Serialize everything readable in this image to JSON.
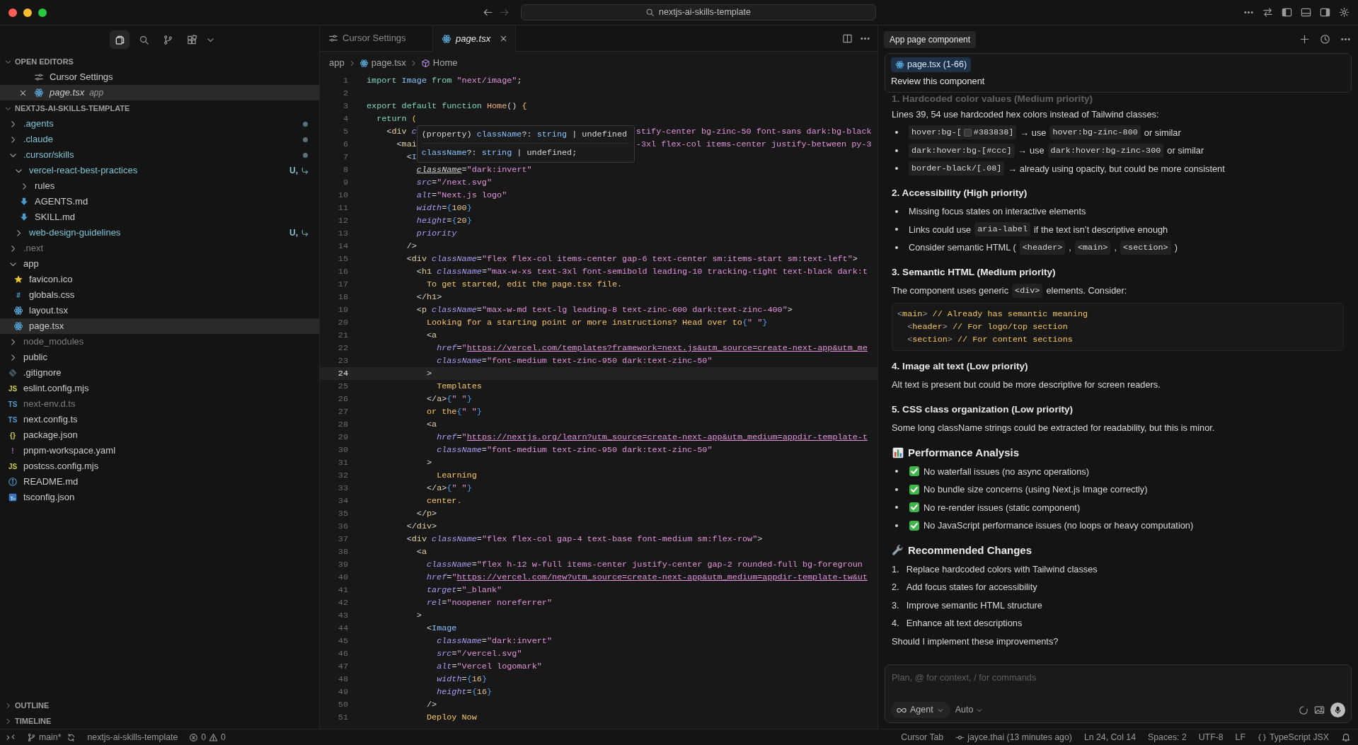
{
  "titlebar": {
    "search": "nextjs-ai-skills-template"
  },
  "sidebar": {
    "views": [
      {
        "kind": "files",
        "selected": true
      },
      {
        "kind": "search",
        "selected": false
      },
      {
        "kind": "source_control",
        "selected": false
      },
      {
        "kind": "extensions",
        "selected": false
      }
    ],
    "open_editors": {
      "title": "OPEN EDITORS",
      "expanded": true,
      "items": [
        {
          "label": "Cursor Settings",
          "kind": "settings_file",
          "selected": false
        },
        {
          "label": "page.tsx",
          "detail": "app",
          "kind": "react_file",
          "selected": true
        }
      ]
    },
    "explorer": {
      "title": "NEXTJS-AI-SKILLS-TEMPLATE",
      "expanded": true,
      "items": [
        {
          "label": ".agents",
          "kind": "folder",
          "expanded": false,
          "selected": false,
          "git_changed": true,
          "dot": true
        },
        {
          "label": ".claude",
          "kind": "folder",
          "expanded": false,
          "selected": false,
          "git_changed": true,
          "dot": true
        },
        {
          "label": ".cursor/skills",
          "kind": "folder",
          "expanded": true,
          "selected": false,
          "git_changed": true,
          "dot": true,
          "children": [
            {
              "label": "vercel-react-best-practices",
              "kind": "folder",
              "expanded": true,
              "selected": false,
              "git_changed": true,
              "decoration": "U,",
              "linked": true,
              "children": [
                {
                  "label": "rules",
                  "kind": "folder",
                  "expanded": false,
                  "selected": false
                },
                {
                  "label": "AGENTS.md",
                  "kind": "markdown_file",
                  "selected": false
                },
                {
                  "label": "SKILL.md",
                  "kind": "markdown_file",
                  "selected": false
                }
              ]
            },
            {
              "label": "web-design-guidelines",
              "kind": "folder",
              "expanded": false,
              "selected": false,
              "git_changed": true,
              "decoration": "U,",
              "linked": true
            }
          ]
        },
        {
          "label": ".next",
          "kind": "folder",
          "expanded": false,
          "selected": false,
          "ignored": true
        },
        {
          "label": "app",
          "kind": "folder",
          "expanded": true,
          "selected": false,
          "children": [
            {
              "label": "favicon.ico",
              "kind": "favicon_file",
              "selected": false
            },
            {
              "label": "globals.css",
              "kind": "css_file",
              "icon_text": "#",
              "selected": false
            },
            {
              "label": "layout.tsx",
              "kind": "react_file",
              "selected": false
            },
            {
              "label": "page.tsx",
              "kind": "react_file",
              "selected": true
            }
          ]
        },
        {
          "label": "node_modules",
          "kind": "folder",
          "expanded": false,
          "selected": false,
          "ignored": true
        },
        {
          "label": "public",
          "kind": "folder",
          "expanded": false,
          "selected": false
        },
        {
          "label": ".gitignore",
          "kind": "gitignore_file",
          "selected": false
        },
        {
          "label": "eslint.config.mjs",
          "kind": "js_file",
          "icon_text": "JS",
          "selected": false
        },
        {
          "label": "next-env.d.ts",
          "kind": "ts_file",
          "icon_text": "TS",
          "selected": false,
          "ignored": true
        },
        {
          "label": "next.config.ts",
          "kind": "ts_file",
          "icon_text": "TS",
          "selected": false
        },
        {
          "label": "package.json",
          "kind": "json_file",
          "icon_text": "{}",
          "selected": false
        },
        {
          "label": "pnpm-workspace.yaml",
          "kind": "yaml_file",
          "icon_text": "!",
          "selected": false
        },
        {
          "label": "postcss.config.mjs",
          "kind": "js_file",
          "icon_text": "JS",
          "selected": false
        },
        {
          "label": "README.md",
          "kind": "readme_file",
          "selected": false
        },
        {
          "label": "tsconfig.json",
          "kind": "tsconfig_file",
          "selected": false
        }
      ]
    },
    "collapsed_sections": [
      {
        "title": "OUTLINE",
        "expanded": false
      },
      {
        "title": "TIMELINE",
        "expanded": false
      }
    ]
  },
  "editor": {
    "tabs": [
      {
        "label": "Cursor Settings",
        "kind": "settings_file",
        "selected": false
      },
      {
        "label": "page.tsx",
        "kind": "react_file",
        "selected": true
      }
    ],
    "breadcrumb": [
      {
        "text": "app",
        "kind": "folder"
      },
      {
        "text": "page.tsx",
        "kind": "react_file"
      },
      {
        "text": "Home",
        "kind": "symbol"
      }
    ],
    "hover": {
      "lines": [
        {
          "tokens": [
            {
              "kind": "plain",
              "text": "(property) "
            },
            {
              "kind": "component",
              "text": "className"
            },
            {
              "kind": "plain",
              "text": "?: "
            },
            {
              "kind": "component",
              "text": "string"
            },
            {
              "kind": "plain",
              "text": " | undefined"
            }
          ]
        },
        {
          "tokens": [
            {
              "kind": "component",
              "text": "className"
            },
            {
              "kind": "plain",
              "text": "?: "
            },
            {
              "kind": "component",
              "text": "string"
            },
            {
              "kind": "plain",
              "text": " | undefined;"
            }
          ]
        }
      ]
    },
    "lines": [
      {
        "number": "1",
        "current": false,
        "tokens": [
          {
            "kind": "keyword",
            "text": "import "
          },
          {
            "kind": "component",
            "text": "Image"
          },
          {
            "kind": "keyword",
            "text": " from "
          },
          {
            "kind": "string",
            "text": "\"next/image\""
          },
          {
            "kind": "punct",
            "text": ";"
          }
        ]
      },
      {
        "number": "2",
        "current": false
      },
      {
        "number": "3",
        "current": false,
        "tokens": [
          {
            "kind": "keyword",
            "text": "export default function "
          },
          {
            "kind": "function",
            "text": "Home"
          },
          {
            "kind": "punct",
            "text": "() "
          },
          {
            "kind": "bracket",
            "text": "{"
          }
        ]
      },
      {
        "number": "4",
        "current": false,
        "tokens": [
          {
            "kind": "keyword",
            "text": "  return "
          },
          {
            "kind": "bracket",
            "text": "("
          }
        ]
      },
      {
        "number": "5",
        "current": false,
        "tokens": [
          {
            "kind": "punct",
            "text": "    <"
          },
          {
            "kind": "tag",
            "text": "div"
          },
          {
            "kind": "attr",
            "text": " c"
          }
        ],
        "after_popup": [
          {
            "kind": "string",
            "text": "stify-center bg-zinc-50 font-sans dark:bg-black"
          }
        ]
      },
      {
        "number": "6",
        "current": false,
        "tokens": [
          {
            "kind": "punct",
            "text": "      <"
          },
          {
            "kind": "tag",
            "text": "mai"
          }
        ],
        "after_popup": [
          {
            "kind": "string",
            "text": "-3xl flex-col items-center justify-between py-3"
          }
        ]
      },
      {
        "number": "7",
        "current": false,
        "tokens": [
          {
            "kind": "punct",
            "text": "        <"
          },
          {
            "kind": "component",
            "text": "I"
          }
        ]
      },
      {
        "number": "8",
        "current": false,
        "tokens": [
          {
            "kind": "attr",
            "text": "          className",
            "underline": true
          },
          {
            "kind": "punct",
            "text": "="
          },
          {
            "kind": "string",
            "text": "\"dark:invert\""
          }
        ]
      },
      {
        "number": "9",
        "current": false,
        "tokens": [
          {
            "kind": "attr",
            "text": "          src"
          },
          {
            "kind": "punct",
            "text": "="
          },
          {
            "kind": "string",
            "text": "\"/next.svg\""
          }
        ]
      },
      {
        "number": "10",
        "current": false,
        "tokens": [
          {
            "kind": "attr",
            "text": "          alt"
          },
          {
            "kind": "punct",
            "text": "="
          },
          {
            "kind": "string",
            "text": "\"Next.js logo\""
          }
        ]
      },
      {
        "number": "11",
        "current": false,
        "tokens": [
          {
            "kind": "attr",
            "text": "          width"
          },
          {
            "kind": "punct",
            "text": "="
          },
          {
            "kind": "brace",
            "text": "{"
          },
          {
            "kind": "number",
            "text": "100"
          },
          {
            "kind": "brace",
            "text": "}"
          }
        ]
      },
      {
        "number": "12",
        "current": false,
        "tokens": [
          {
            "kind": "attr",
            "text": "          height"
          },
          {
            "kind": "punct",
            "text": "="
          },
          {
            "kind": "brace",
            "text": "{"
          },
          {
            "kind": "number",
            "text": "20"
          },
          {
            "kind": "brace",
            "text": "}"
          }
        ]
      },
      {
        "number": "13",
        "current": false,
        "tokens": [
          {
            "kind": "attr",
            "text": "          priority"
          }
        ]
      },
      {
        "number": "14",
        "current": false,
        "tokens": [
          {
            "kind": "punct",
            "text": "        />"
          }
        ]
      },
      {
        "number": "15",
        "current": false,
        "tokens": [
          {
            "kind": "punct",
            "text": "        <"
          },
          {
            "kind": "tag",
            "text": "div"
          },
          {
            "kind": "attr",
            "text": " className"
          },
          {
            "kind": "punct",
            "text": "="
          },
          {
            "kind": "string",
            "text": "\"flex flex-col items-center gap-6 text-center sm:items-start sm:text-left\""
          },
          {
            "kind": "punct",
            "text": ">"
          }
        ]
      },
      {
        "number": "16",
        "current": false,
        "tokens": [
          {
            "kind": "punct",
            "text": "          <"
          },
          {
            "kind": "tag",
            "text": "h1"
          },
          {
            "kind": "attr",
            "text": " className"
          },
          {
            "kind": "punct",
            "text": "="
          },
          {
            "kind": "string",
            "text": "\"max-w-xs text-3xl font-semibold leading-10 tracking-tight text-black dark:t"
          }
        ]
      },
      {
        "number": "17",
        "current": false,
        "tokens": [
          {
            "kind": "text",
            "text": "            To get started, edit the page.tsx file."
          }
        ]
      },
      {
        "number": "18",
        "current": false,
        "tokens": [
          {
            "kind": "punct",
            "text": "          </"
          },
          {
            "kind": "tag",
            "text": "h1"
          },
          {
            "kind": "punct",
            "text": ">"
          }
        ]
      },
      {
        "number": "19",
        "current": false,
        "tokens": [
          {
            "kind": "punct",
            "text": "          <"
          },
          {
            "kind": "tag",
            "text": "p"
          },
          {
            "kind": "attr",
            "text": " className"
          },
          {
            "kind": "punct",
            "text": "="
          },
          {
            "kind": "string",
            "text": "\"max-w-md text-lg leading-8 text-zinc-600 dark:text-zinc-400\""
          },
          {
            "kind": "punct",
            "text": ">"
          }
        ]
      },
      {
        "number": "20",
        "current": false,
        "tokens": [
          {
            "kind": "text",
            "text": "            Looking for a starting point or more instructions? Head over to"
          },
          {
            "kind": "brace",
            "text": "{"
          },
          {
            "kind": "string",
            "text": "\" \""
          },
          {
            "kind": "brace",
            "text": "}"
          }
        ]
      },
      {
        "number": "21",
        "current": false,
        "tokens": [
          {
            "kind": "punct",
            "text": "            <"
          },
          {
            "kind": "tag",
            "text": "a"
          }
        ]
      },
      {
        "number": "22",
        "current": false,
        "tokens": [
          {
            "kind": "attr",
            "text": "              href"
          },
          {
            "kind": "punct",
            "text": "="
          },
          {
            "kind": "string",
            "text": "\""
          },
          {
            "kind": "link",
            "text": "https://vercel.com/templates?framework=next.js&utm_source=create-next-app&utm_me"
          }
        ]
      },
      {
        "number": "23",
        "current": false,
        "tokens": [
          {
            "kind": "attr",
            "text": "              className"
          },
          {
            "kind": "punct",
            "text": "="
          },
          {
            "kind": "string",
            "text": "\"font-medium text-zinc-950 dark:text-zinc-50\""
          }
        ]
      },
      {
        "number": "24",
        "current": true,
        "tokens": [
          {
            "kind": "punct",
            "text": "            >"
          }
        ]
      },
      {
        "number": "25",
        "current": false,
        "tokens": [
          {
            "kind": "text",
            "text": "              Templates"
          }
        ]
      },
      {
        "number": "26",
        "current": false,
        "tokens": [
          {
            "kind": "punct",
            "text": "            </"
          },
          {
            "kind": "tag",
            "text": "a"
          },
          {
            "kind": "punct",
            "text": ">"
          },
          {
            "kind": "brace",
            "text": "{"
          },
          {
            "kind": "string",
            "text": "\" \""
          },
          {
            "kind": "brace",
            "text": "}"
          }
        ]
      },
      {
        "number": "27",
        "current": false,
        "tokens": [
          {
            "kind": "text",
            "text": "            or the"
          },
          {
            "kind": "brace",
            "text": "{"
          },
          {
            "kind": "string",
            "text": "\" \""
          },
          {
            "kind": "brace",
            "text": "}"
          }
        ]
      },
      {
        "number": "28",
        "current": false,
        "tokens": [
          {
            "kind": "punct",
            "text": "            <"
          },
          {
            "kind": "tag",
            "text": "a"
          }
        ]
      },
      {
        "number": "29",
        "current": false,
        "tokens": [
          {
            "kind": "attr",
            "text": "              href"
          },
          {
            "kind": "punct",
            "text": "="
          },
          {
            "kind": "string",
            "text": "\""
          },
          {
            "kind": "link",
            "text": "https://nextjs.org/learn?utm_source=create-next-app&utm_medium=appdir-template-t"
          }
        ]
      },
      {
        "number": "30",
        "current": false,
        "tokens": [
          {
            "kind": "attr",
            "text": "              className"
          },
          {
            "kind": "punct",
            "text": "="
          },
          {
            "kind": "string",
            "text": "\"font-medium text-zinc-950 dark:text-zinc-50\""
          }
        ]
      },
      {
        "number": "31",
        "current": false,
        "tokens": [
          {
            "kind": "punct",
            "text": "            >"
          }
        ]
      },
      {
        "number": "32",
        "current": false,
        "tokens": [
          {
            "kind": "text",
            "text": "              Learning"
          }
        ]
      },
      {
        "number": "33",
        "current": false,
        "tokens": [
          {
            "kind": "punct",
            "text": "            </"
          },
          {
            "kind": "tag",
            "text": "a"
          },
          {
            "kind": "punct",
            "text": ">"
          },
          {
            "kind": "brace",
            "text": "{"
          },
          {
            "kind": "string",
            "text": "\" \""
          },
          {
            "kind": "brace",
            "text": "}"
          }
        ]
      },
      {
        "number": "34",
        "current": false,
        "tokens": [
          {
            "kind": "text",
            "text": "            center."
          }
        ]
      },
      {
        "number": "35",
        "current": false,
        "tokens": [
          {
            "kind": "punct",
            "text": "          </"
          },
          {
            "kind": "tag",
            "text": "p"
          },
          {
            "kind": "punct",
            "text": ">"
          }
        ]
      },
      {
        "number": "36",
        "current": false,
        "tokens": [
          {
            "kind": "punct",
            "text": "        </"
          },
          {
            "kind": "tag",
            "text": "div"
          },
          {
            "kind": "punct",
            "text": ">"
          }
        ]
      },
      {
        "number": "37",
        "current": false,
        "tokens": [
          {
            "kind": "punct",
            "text": "        <"
          },
          {
            "kind": "tag",
            "text": "div"
          },
          {
            "kind": "attr",
            "text": " className"
          },
          {
            "kind": "punct",
            "text": "="
          },
          {
            "kind": "string",
            "text": "\"flex flex-col gap-4 text-base font-medium sm:flex-row\""
          },
          {
            "kind": "punct",
            "text": ">"
          }
        ]
      },
      {
        "number": "38",
        "current": false,
        "tokens": [
          {
            "kind": "punct",
            "text": "          <"
          },
          {
            "kind": "tag",
            "text": "a"
          }
        ]
      },
      {
        "number": "39",
        "current": false,
        "tokens": [
          {
            "kind": "attr",
            "text": "            className"
          },
          {
            "kind": "punct",
            "text": "="
          },
          {
            "kind": "string",
            "text": "\"flex h-12 w-full items-center justify-center gap-2 rounded-full bg-foregroun"
          }
        ]
      },
      {
        "number": "40",
        "current": false,
        "tokens": [
          {
            "kind": "attr",
            "text": "            href"
          },
          {
            "kind": "punct",
            "text": "="
          },
          {
            "kind": "string",
            "text": "\""
          },
          {
            "kind": "link",
            "text": "https://vercel.com/new?utm_source=create-next-app&utm_medium=appdir-template-tw&ut"
          }
        ]
      },
      {
        "number": "41",
        "current": false,
        "tokens": [
          {
            "kind": "attr",
            "text": "            target"
          },
          {
            "kind": "punct",
            "text": "="
          },
          {
            "kind": "string",
            "text": "\"_blank\""
          }
        ]
      },
      {
        "number": "42",
        "current": false,
        "tokens": [
          {
            "kind": "attr",
            "text": "            rel"
          },
          {
            "kind": "punct",
            "text": "="
          },
          {
            "kind": "string",
            "text": "\"noopener noreferrer\""
          }
        ]
      },
      {
        "number": "43",
        "current": false,
        "tokens": [
          {
            "kind": "punct",
            "text": "          >"
          }
        ]
      },
      {
        "number": "44",
        "current": false,
        "tokens": [
          {
            "kind": "punct",
            "text": "            <"
          },
          {
            "kind": "component",
            "text": "Image"
          }
        ]
      },
      {
        "number": "45",
        "current": false,
        "tokens": [
          {
            "kind": "attr",
            "text": "              className"
          },
          {
            "kind": "punct",
            "text": "="
          },
          {
            "kind": "string",
            "text": "\"dark:invert\""
          }
        ]
      },
      {
        "number": "46",
        "current": false,
        "tokens": [
          {
            "kind": "attr",
            "text": "              src"
          },
          {
            "kind": "punct",
            "text": "="
          },
          {
            "kind": "string",
            "text": "\"/vercel.svg\""
          }
        ]
      },
      {
        "number": "47",
        "current": false,
        "tokens": [
          {
            "kind": "attr",
            "text": "              alt"
          },
          {
            "kind": "punct",
            "text": "="
          },
          {
            "kind": "string",
            "text": "\"Vercel logomark\""
          }
        ]
      },
      {
        "number": "48",
        "current": false,
        "tokens": [
          {
            "kind": "attr",
            "text": "              width"
          },
          {
            "kind": "punct",
            "text": "="
          },
          {
            "kind": "brace",
            "text": "{"
          },
          {
            "kind": "number",
            "text": "16"
          },
          {
            "kind": "brace",
            "text": "}"
          }
        ]
      },
      {
        "number": "49",
        "current": false,
        "tokens": [
          {
            "kind": "attr",
            "text": "              height"
          },
          {
            "kind": "punct",
            "text": "="
          },
          {
            "kind": "brace",
            "text": "{"
          },
          {
            "kind": "number",
            "text": "16"
          },
          {
            "kind": "brace",
            "text": "}"
          }
        ]
      },
      {
        "number": "50",
        "current": false,
        "tokens": [
          {
            "kind": "punct",
            "text": "            />"
          }
        ]
      },
      {
        "number": "51",
        "current": false,
        "tokens": [
          {
            "kind": "text",
            "text": "            Deploy Now"
          }
        ]
      }
    ]
  },
  "chat": {
    "title": "App page component",
    "context": {
      "file": "page.tsx (1-66)",
      "prompt": "Review this component"
    },
    "blocks": [
      {
        "kind": "heading",
        "faded": true,
        "text": "1. Hardcoded color values (Medium priority)"
      },
      {
        "kind": "paragraph",
        "segments": [
          {
            "kind": "text",
            "text": "Lines 39, 54 use hardcoded hex colors instead of Tailwind classes:"
          }
        ]
      },
      {
        "kind": "bullets",
        "items": [
          {
            "segments": [
              {
                "kind": "code",
                "text": "hover:bg-[",
                "color": "#383838",
                "text_after": "#383838]"
              },
              {
                "kind": "text",
                "text": "→ use"
              },
              {
                "kind": "code",
                "text": "hover:bg-zinc-800"
              },
              {
                "kind": "text",
                "text": "or similar"
              }
            ]
          },
          {
            "segments": [
              {
                "kind": "code",
                "text": "dark:hover:bg-[#ccc]"
              },
              {
                "kind": "text",
                "text": "→ use"
              },
              {
                "kind": "code",
                "text": "dark:hover:bg-zinc-300"
              },
              {
                "kind": "text",
                "text": "or similar"
              }
            ]
          },
          {
            "segments": [
              {
                "kind": "code",
                "text": "border-black/[.08]"
              },
              {
                "kind": "text",
                "text": "→ already using opacity, but could be more consistent"
              }
            ]
          }
        ]
      },
      {
        "kind": "heading",
        "faded": false,
        "text": "2. Accessibility (High priority)"
      },
      {
        "kind": "bullets",
        "items": [
          {
            "segments": [
              {
                "kind": "text",
                "text": "Missing focus states on interactive elements"
              }
            ]
          },
          {
            "segments": [
              {
                "kind": "text",
                "text": "Links could use"
              },
              {
                "kind": "code",
                "text": "aria-label"
              },
              {
                "kind": "text",
                "text": "if the text isn’t descriptive enough"
              }
            ]
          },
          {
            "segments": [
              {
                "kind": "text",
                "text": "Consider semantic HTML ("
              },
              {
                "kind": "code",
                "text": "<header>"
              },
              {
                "kind": "text",
                "text": ","
              },
              {
                "kind": "code",
                "text": "<main>"
              },
              {
                "kind": "text",
                "text": ","
              },
              {
                "kind": "code",
                "text": "<section>"
              },
              {
                "kind": "text",
                "text": ")"
              }
            ]
          }
        ]
      },
      {
        "kind": "heading",
        "faded": false,
        "text": "3. Semantic HTML (Medium priority)"
      },
      {
        "kind": "paragraph",
        "segments": [
          {
            "kind": "text",
            "text": "The component uses generic"
          },
          {
            "kind": "code",
            "text": "<div>"
          },
          {
            "kind": "text",
            "text": "elements. Consider:"
          }
        ]
      },
      {
        "kind": "code_block",
        "lines": [
          {
            "tokens": [
              {
                "kind": "punct",
                "text": "<"
              },
              {
                "kind": "text",
                "text": "main"
              },
              {
                "kind": "punct",
                "text": ">"
              },
              {
                "kind": "text",
                "text": " // Already has semantic meaning"
              }
            ]
          },
          {
            "tokens": [
              {
                "kind": "punct",
                "text": "  <"
              },
              {
                "kind": "text",
                "text": "header"
              },
              {
                "kind": "punct",
                "text": ">"
              },
              {
                "kind": "text",
                "text": " // For logo/top section"
              }
            ]
          },
          {
            "tokens": [
              {
                "kind": "punct",
                "text": "  <"
              },
              {
                "kind": "text",
                "text": "section"
              },
              {
                "kind": "punct",
                "text": ">"
              },
              {
                "kind": "text",
                "text": " // For content sections"
              }
            ]
          }
        ]
      },
      {
        "kind": "heading",
        "faded": false,
        "text": "4. Image alt text (Low priority)"
      },
      {
        "kind": "paragraph",
        "segments": [
          {
            "kind": "text",
            "text": "Alt text is present but could be more descriptive for screen readers."
          }
        ]
      },
      {
        "kind": "heading",
        "faded": false,
        "text": "5. CSS class organization (Low priority)"
      },
      {
        "kind": "paragraph",
        "segments": [
          {
            "kind": "text",
            "text": "Some long className strings could be extracted for readability, but this is minor."
          }
        ]
      },
      {
        "kind": "major_heading",
        "text": "Performance Analysis"
      },
      {
        "kind": "bullets",
        "items": [
          {
            "checked": true,
            "segments": [
              {
                "kind": "text",
                "text": "No waterfall issues (no async operations)"
              }
            ]
          },
          {
            "checked": true,
            "segments": [
              {
                "kind": "text",
                "text": "No bundle size concerns (using Next.js Image correctly)"
              }
            ]
          },
          {
            "checked": true,
            "segments": [
              {
                "kind": "text",
                "text": "No re-render issues (static component)"
              }
            ]
          },
          {
            "checked": true,
            "segments": [
              {
                "kind": "text",
                "text": "No JavaScript performance issues (no loops or heavy computation)"
              }
            ]
          }
        ]
      },
      {
        "kind": "major_heading",
        "text": "Recommended Changes"
      },
      {
        "kind": "numbered",
        "items": [
          {
            "number": "1.",
            "text": "Replace hardcoded colors with Tailwind classes"
          },
          {
            "number": "2.",
            "text": "Add focus states for accessibility"
          },
          {
            "number": "3.",
            "text": "Improve semantic HTML structure"
          },
          {
            "number": "4.",
            "text": "Enhance alt text descriptions"
          }
        ]
      },
      {
        "kind": "paragraph",
        "segments": [
          {
            "kind": "text",
            "text": "Should I implement these improvements?"
          }
        ]
      }
    ],
    "input": {
      "placeholder": "Plan, @ for context, / for commands",
      "mode": "Agent",
      "model": "Auto"
    }
  },
  "status_bar": {
    "branch": "main*",
    "workspace": "nextjs-ai-skills-template",
    "errors": "0",
    "warnings": "0",
    "items": [
      {
        "kind": "plain",
        "text": "Cursor Tab"
      },
      {
        "kind": "blame",
        "text": "jayce.thai (13 minutes ago)"
      },
      {
        "kind": "plain",
        "text": "Ln 24, Col 14"
      },
      {
        "kind": "plain",
        "text": "Spaces: 2"
      },
      {
        "kind": "plain",
        "text": "UTF-8"
      },
      {
        "kind": "plain",
        "text": "LF"
      },
      {
        "kind": "language",
        "text": "TypeScript JSX"
      }
    ]
  }
}
